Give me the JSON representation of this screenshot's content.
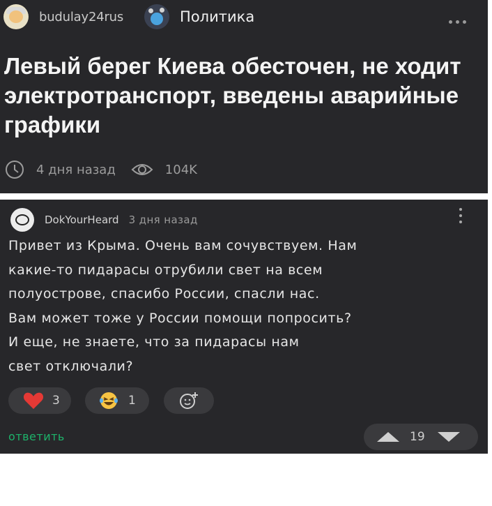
{
  "post": {
    "author": "budulay24rus",
    "community": "Политика",
    "title": "Левый берег Киева обесточен, не ходит электротранспорт, введены аварийные графики",
    "time": "4 дня назад",
    "views": "104K"
  },
  "comment": {
    "author": "DokYourHeard",
    "time": "3 дня назад",
    "lines": [
      "Привет из Крыма. Очень вам сочувствуем. Нам",
      "какие-то пидарасы отрубили свет на всем",
      "полуострове, спасибо России, спасли нас.",
      "Вам может тоже у России помощи попросить?",
      "И еще, не знаете, что за пидарасы нам",
      "свет отключали?"
    ],
    "reactions": {
      "heart": "3",
      "laugh": "1"
    },
    "reply_label": "ответить",
    "score": "19"
  },
  "icons": {
    "post_avatar": "user-avatar-icon",
    "community_avatar": "community-icon",
    "more": "more-horizontal-icon",
    "clock": "clock-icon",
    "views": "eye-icon",
    "comment_avatar": "user-avatar-icon",
    "comment_menu": "more-vertical-icon",
    "heart": "heart-icon",
    "laugh": "laughing-emoji-icon",
    "add_reaction": "add-reaction-icon",
    "upvote": "upvote-icon",
    "downvote": "downvote-icon"
  },
  "colors": {
    "panel": "#27272a",
    "accent_green": "#1db36a",
    "heart": "#e53935",
    "pill": "#3a3a3d"
  }
}
